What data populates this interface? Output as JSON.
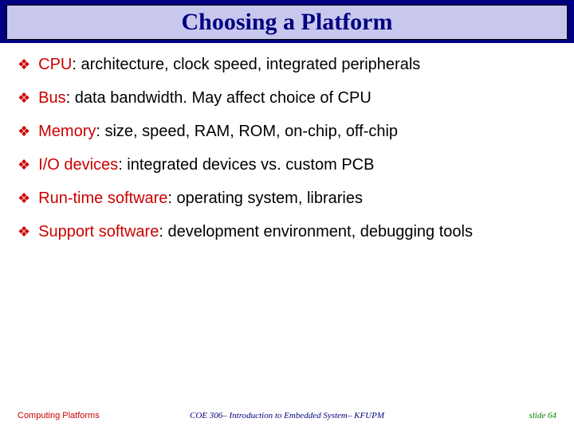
{
  "title": "Choosing a Platform",
  "items": [
    {
      "label": "CPU",
      "desc": ": architecture, clock speed, integrated peripherals"
    },
    {
      "label": "Bus",
      "desc": ": data bandwidth. May affect choice of CPU"
    },
    {
      "label": "Memory",
      "desc": ": size, speed, RAM, ROM, on-chip, off-chip"
    },
    {
      "label": "I/O devices",
      "desc": ": integrated devices vs. custom PCB"
    },
    {
      "label": "Run-time software",
      "desc": ": operating system, libraries"
    },
    {
      "label": "Support software",
      "desc": ": development environment, debugging tools"
    }
  ],
  "footer": {
    "left": "Computing Platforms",
    "center": "COE 306– Introduction to Embedded System– KFUPM",
    "right": "slide 64"
  },
  "bullet_glyph": "❖"
}
